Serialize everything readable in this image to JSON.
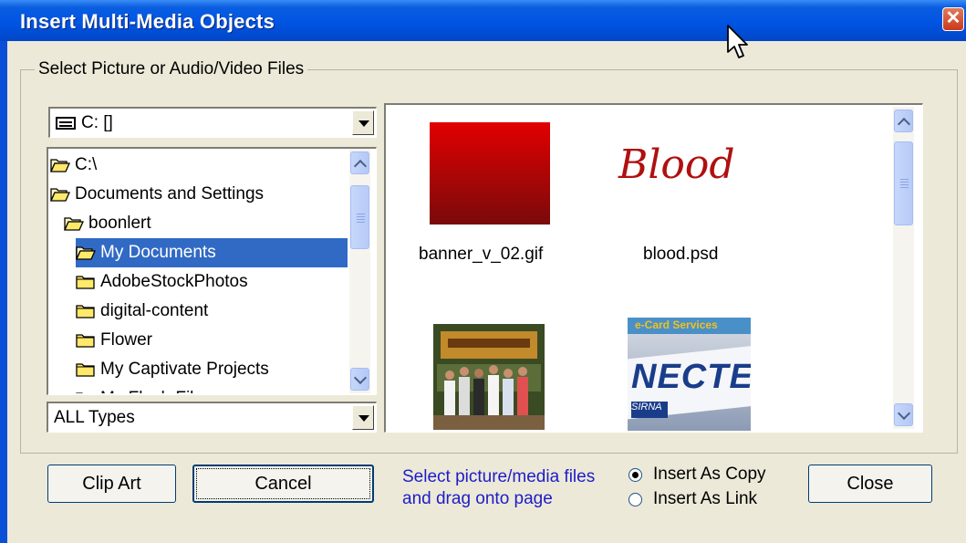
{
  "window": {
    "title": "Insert Multi-Media Objects",
    "close_glyph": "✕"
  },
  "group": {
    "label": "Select Picture or Audio/Video Files"
  },
  "drive_combo": {
    "value": "C: []",
    "icon": "drive-icon"
  },
  "folder_tree": {
    "items": [
      {
        "label": "C:\\",
        "state": "open"
      },
      {
        "label": "Documents and Settings",
        "state": "open"
      },
      {
        "label": "boonlert",
        "state": "open"
      },
      {
        "label": "My Documents",
        "state": "open",
        "selected": true
      },
      {
        "label": "AdobeStockPhotos",
        "state": "closed"
      },
      {
        "label": "digital-content",
        "state": "closed"
      },
      {
        "label": "Flower",
        "state": "closed"
      },
      {
        "label": "My Captivate Projects",
        "state": "closed"
      },
      {
        "label": "My Flash Files",
        "state": "closed"
      }
    ]
  },
  "type_combo": {
    "value": "ALL Types"
  },
  "files": [
    {
      "name": "banner_v_02.gif",
      "thumb": "red-gradient"
    },
    {
      "name": "blood.psd",
      "thumb": "text",
      "thumb_text": "Blood"
    },
    {
      "name": "",
      "thumb": "group-photo"
    },
    {
      "name": "",
      "thumb": "ecard-photo",
      "thumb_text_top": "e-Card Services",
      "thumb_text_main": "NECTE",
      "thumb_text_sub": "SIRNA"
    }
  ],
  "buttons": {
    "clipart": "Clip Art",
    "cancel": "Cancel",
    "close": "Close"
  },
  "hint": {
    "line1": "Select picture/media files",
    "line2": "and drag onto page"
  },
  "insert_mode": {
    "copy": "Insert As Copy",
    "link": "Insert As Link",
    "selected": "copy"
  },
  "colors": {
    "titlebar": "#0054E3",
    "selection": "#316AC5",
    "hint_text": "#1D1DC8",
    "dialog_bg": "#ECE9D8"
  }
}
